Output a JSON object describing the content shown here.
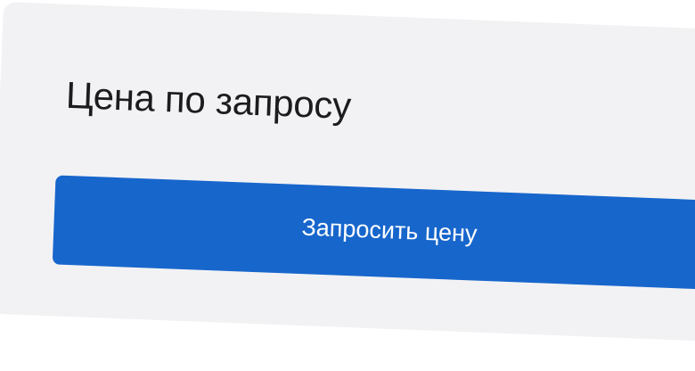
{
  "price_card": {
    "title": "Цена по запросу",
    "button_label": "Запросить цену"
  },
  "colors": {
    "card_background": "#f2f2f4",
    "button_background": "#1766cc",
    "button_text": "#ffffff",
    "title_text": "#1c1c1e"
  }
}
